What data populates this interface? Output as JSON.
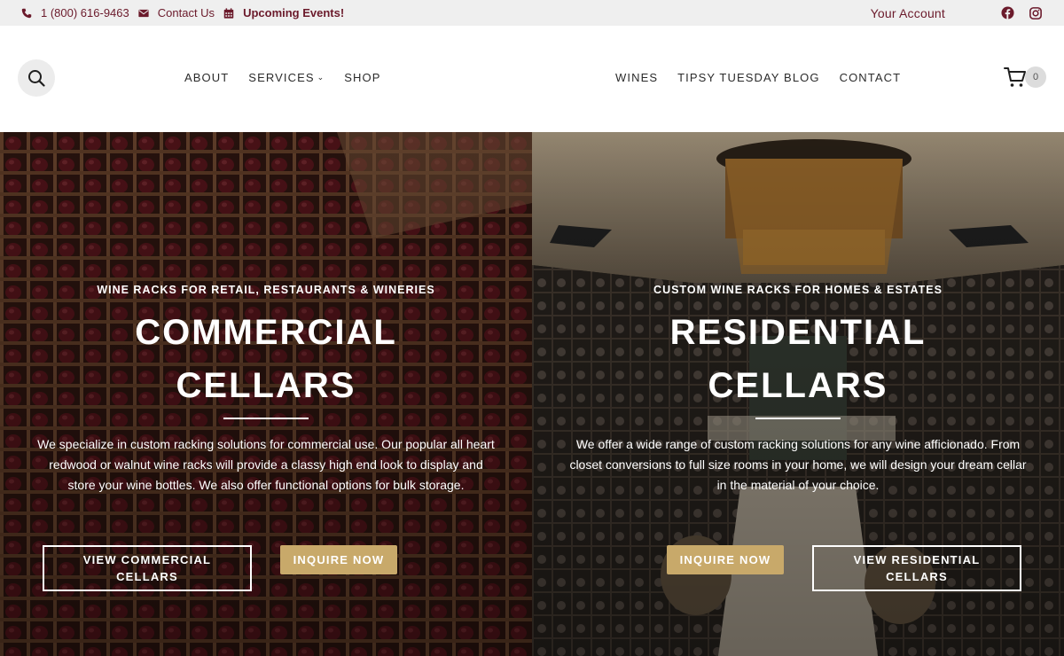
{
  "topbar": {
    "phone": "1 (800) 616-9463",
    "contact": "Contact Us",
    "events": "Upcoming Events!",
    "account": "Your Account",
    "social": [
      "facebook-icon",
      "instagram-icon"
    ],
    "color": "#6b1a2b"
  },
  "header": {
    "nav_left": [
      {
        "label": "ABOUT"
      },
      {
        "label": "SERVICES"
      },
      {
        "label": "SHOP"
      }
    ],
    "nav_right": [
      {
        "label": "WINES"
      },
      {
        "label": "TIPSY TUESDAY BLOG"
      },
      {
        "label": "CONTACT"
      }
    ],
    "cart_count": "0"
  },
  "commercial": {
    "eyebrow": "WINE RACKS FOR RETAIL, RESTAURANTS & WINERIES",
    "title_line1": "COMMERCIAL",
    "title_line2": "CELLARS",
    "description": "We specialize in custom racking solutions for commercial use. Our popular all heart redwood or walnut wine racks will provide a classy high end look to display and store your wine bottles. We also offer functional options for bulk storage.",
    "btn_view": "VIEW COMMERCIAL CELLARS",
    "btn_inquire": "INQUIRE NOW"
  },
  "residential": {
    "eyebrow": "CUSTOM WINE RACKS FOR HOMES & ESTATES",
    "title_line1": "RESIDENTIAL",
    "title_line2": "CELLARS",
    "description": "We offer a wide range of custom racking solutions for any wine afficionado. From closet conversions to full size rooms in your home, we will design your dream cellar in the material of your choice.",
    "btn_inquire": "INQUIRE NOW",
    "btn_view": "VIEW RESIDENTIAL CELLARS"
  },
  "colors": {
    "accent_gold": "#c8a96a",
    "brand_maroon": "#6b1a2b"
  }
}
